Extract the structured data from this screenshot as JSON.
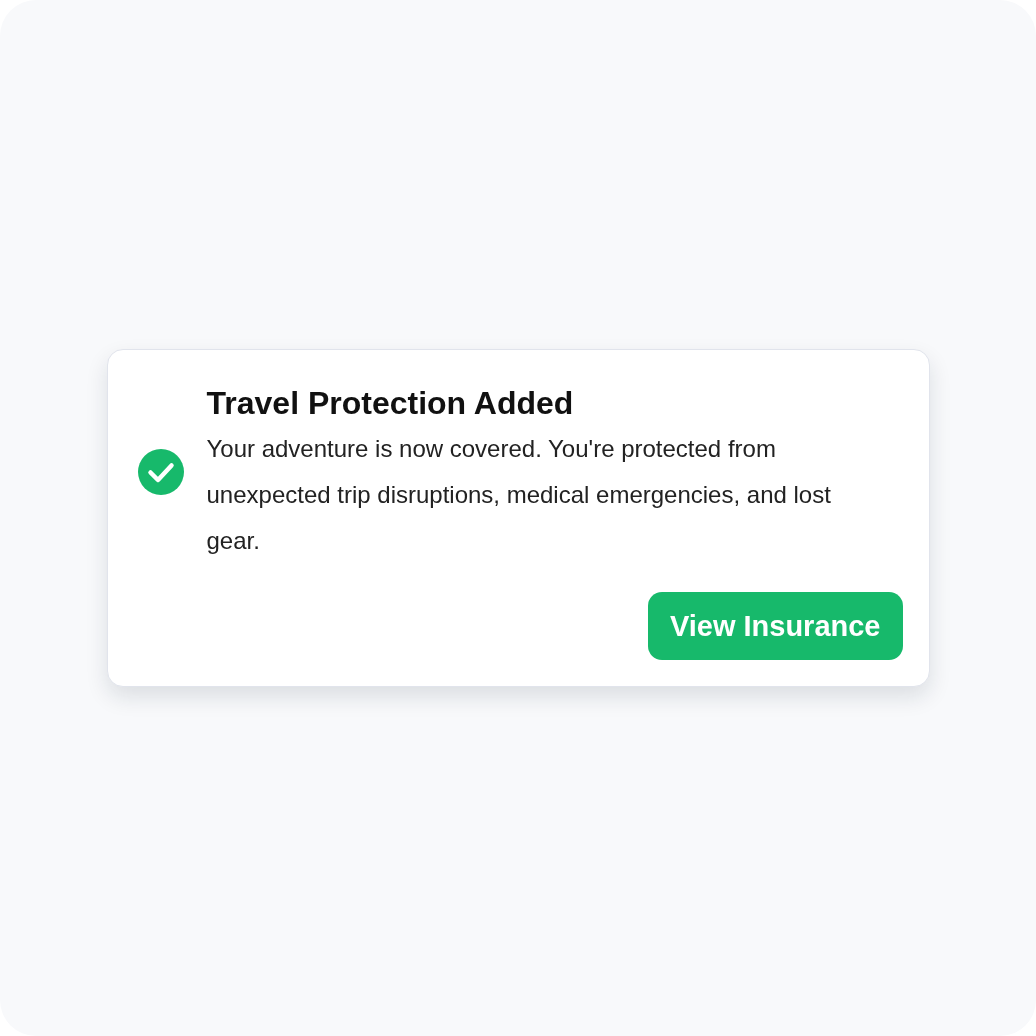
{
  "notification": {
    "title": "Travel Protection Added",
    "message": "Your adventure is now covered. You're protected from unexpected trip disruptions, medical emergencies, and lost gear.",
    "button": "View Insurance"
  }
}
